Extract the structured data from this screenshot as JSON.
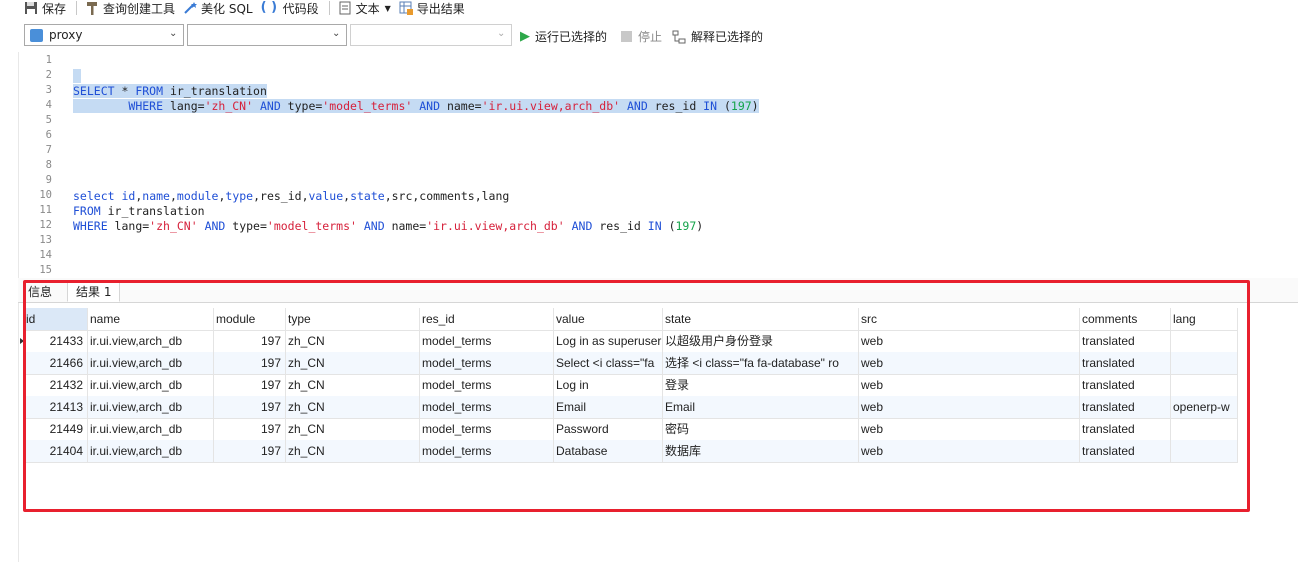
{
  "toolbar": {
    "save": "保存",
    "query_builder": "查询创建工具",
    "beautify_sql": "美化 SQL",
    "code_snippet": "代码段",
    "text": "文本",
    "export_result": "导出结果"
  },
  "connection": {
    "selected": "proxy",
    "database": "",
    "schema": "",
    "run_selected": "运行已选择的",
    "stop": "停止",
    "explain_selected": "解释已选择的"
  },
  "editor": {
    "line_numbers": [
      "1",
      "2",
      "3",
      "4",
      "5",
      "6",
      "7",
      "8",
      "9",
      "10",
      "11",
      "12",
      "13",
      "14",
      "15"
    ]
  },
  "result": {
    "tabs": [
      "信息",
      "结果 1"
    ],
    "columns": [
      "id",
      "name",
      "module",
      "type",
      "res_id",
      "value",
      "state",
      "src",
      "comments",
      "lang"
    ],
    "rows": [
      [
        "21433",
        "ir.ui.view,arch_db",
        "197",
        "zh_CN",
        "model_terms",
        "Log in as superuser",
        "以超级用户身份登录",
        "web",
        "translated",
        ""
      ],
      [
        "21466",
        "ir.ui.view,arch_db",
        "197",
        "zh_CN",
        "model_terms",
        "Select <i class=\"fa",
        "选择 <i class=\"fa fa-database\" ro",
        "web",
        "translated",
        ""
      ],
      [
        "21432",
        "ir.ui.view,arch_db",
        "197",
        "zh_CN",
        "model_terms",
        "Log in",
        "登录",
        "web",
        "translated",
        ""
      ],
      [
        "21413",
        "ir.ui.view,arch_db",
        "197",
        "zh_CN",
        "model_terms",
        "Email",
        "Email",
        "web",
        "translated",
        "openerp-w"
      ],
      [
        "21449",
        "ir.ui.view,arch_db",
        "197",
        "zh_CN",
        "model_terms",
        "Password",
        "密码",
        "web",
        "translated",
        ""
      ],
      [
        "21404",
        "ir.ui.view,arch_db",
        "197",
        "zh_CN",
        "model_terms",
        "Database",
        "数据库",
        "web",
        "translated",
        ""
      ]
    ]
  },
  "colors": {
    "highlight_box": "#e8202e",
    "selection": "#c5dbf3",
    "keyword": "#1f4fd6",
    "string": "#d6213b",
    "number": "#14a34a"
  }
}
